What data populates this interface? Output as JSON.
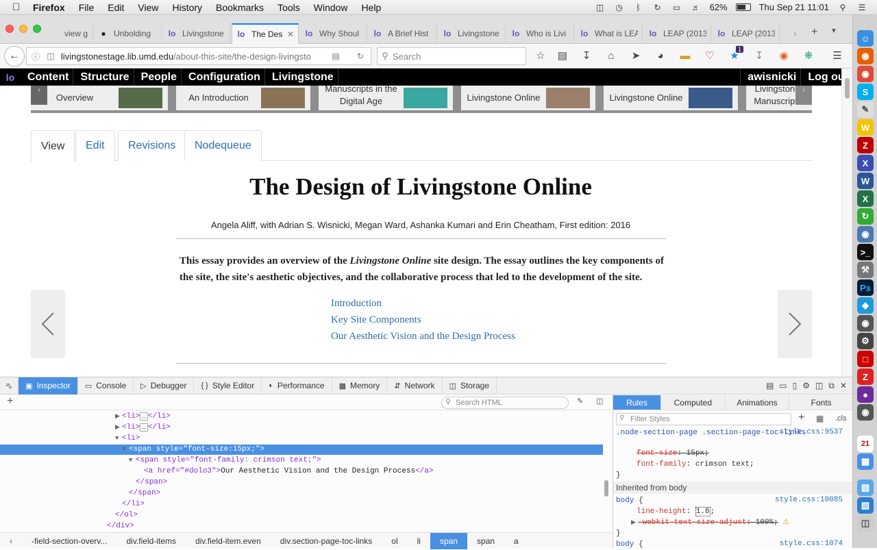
{
  "menubar": {
    "app": "Firefox",
    "items": [
      "File",
      "Edit",
      "View",
      "History",
      "Bookmarks",
      "Tools",
      "Window",
      "Help"
    ],
    "battery": "62%",
    "clock": "Thu Sep 21  11:01"
  },
  "tabs": [
    {
      "label": "view g",
      "icon": "generic"
    },
    {
      "label": "Unbolding",
      "icon": "github"
    },
    {
      "label": "Livingstone",
      "icon": "lo"
    },
    {
      "label": "The Des",
      "icon": "lo",
      "active": true
    },
    {
      "label": "Why Shoul",
      "icon": "lo"
    },
    {
      "label": "A Brief Hist",
      "icon": "lo"
    },
    {
      "label": "Livingstone",
      "icon": "lo"
    },
    {
      "label": "Who is Livi",
      "icon": "lo"
    },
    {
      "label": "What is LEA",
      "icon": "lo"
    },
    {
      "label": "LEAP (2013",
      "icon": "lo"
    },
    {
      "label": "LEAP (2013",
      "icon": "lo"
    }
  ],
  "nav": {
    "url_host": "livingstonestage.lib.umd.edu",
    "url_path": "/about-this-site/the-design-livingsto",
    "search_placeholder": "Search",
    "notification_count": "1"
  },
  "admin": {
    "items": [
      "Content",
      "Structure",
      "People",
      "Configuration",
      "Livingstone"
    ],
    "user": "awisnicki",
    "logout": "Log out"
  },
  "carousel": [
    {
      "text": "Overview",
      "color": "#556b4a"
    },
    {
      "text": "An Introduction",
      "color": "#8b7355"
    },
    {
      "text": "Manuscripts in the Digital Age",
      "color": "#3aa7a0"
    },
    {
      "text": "Livingstone Online",
      "color": "#9a7f6a"
    },
    {
      "text": "Livingstone Online",
      "color": "#3a5a8a"
    },
    {
      "text": "Livingstone's Manuscripts?",
      "color": ""
    }
  ],
  "page_tabs": [
    "View",
    "Edit",
    "Revisions",
    "Nodequeue"
  ],
  "article": {
    "title": "The Design of Livingstone Online",
    "byline": "Angela Aliff, with Adrian S. Wisnicki, Megan Ward, Ashanka Kumari and Erin Cheatham, First edition: 2016",
    "abstract_1": "This essay provides an overview of the ",
    "abstract_em": "Livingstone Online",
    "abstract_2": " site design. The essay outlines the key components of the site, the site's aesthetic objectives, and the collaborative process that led to the development of the site.",
    "toc": [
      "Introduction",
      "Key Site Components",
      "Our Aesthetic Vision and the Design Process"
    ]
  },
  "devtools": {
    "tabs": [
      "Inspector",
      "Console",
      "Debugger",
      "Style Editor",
      "Performance",
      "Memory",
      "Network",
      "Storage"
    ],
    "search_html": "Search HTML",
    "rules_tabs": [
      "Rules",
      "Computed",
      "Animations",
      "Fonts"
    ],
    "filter_placeholder": "Filter Styles",
    "cls": ".cls",
    "markup": {
      "li1": "<li>",
      "li_close": "</li>",
      "span_open": "<span style=\"font-size:15px;\">",
      "span2_open": "<span style=\"font-family: crimson text;\">",
      "a_open": "<a href=\"#dolo3\">",
      "a_href": "#dolo3",
      "a_text": "Our Aesthetic Vision and the Design Process",
      "a_close": "</a>",
      "span_close": "</span>",
      "ol_close": "</ol>",
      "div_close": "</div>"
    },
    "breadcrumbs": [
      "-field-section-overv...",
      "div.field-items",
      "div.field-item.even",
      "div.section-page-toc-links",
      "ol",
      "li",
      "span",
      "span",
      "a"
    ],
    "rules": {
      "sel1": ".node-section-page .section-page-toc-links",
      "src1": "style.css:9537",
      "p1": "font-size",
      "v1": "15px",
      "p2": "font-family",
      "v2": "crimson text",
      "inherited": "Inherited from body",
      "sel2": "body",
      "src2": "style.css:10085",
      "p3": "line-height",
      "v3": "1.6",
      "p4": "-webkit-text-size-adjust",
      "v4": "100%",
      "sel3": "body",
      "src3": "style.css:1074"
    }
  }
}
